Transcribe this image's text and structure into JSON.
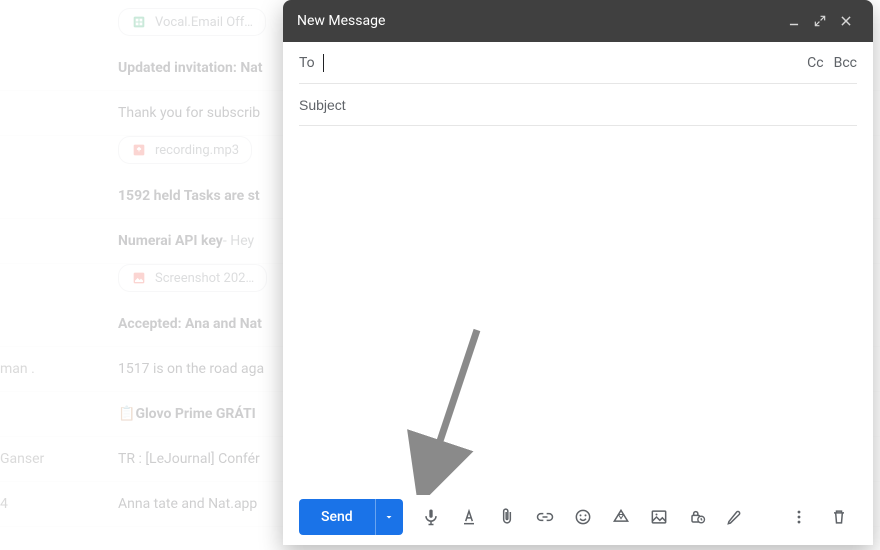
{
  "compose": {
    "title": "New Message",
    "to_label": "To",
    "cc_label": "Cc",
    "bcc_label": "Bcc",
    "subject_placeholder": "Subject",
    "send_label": "Send"
  },
  "inbox": {
    "rows": {
      "r0_chip": "Vocal.Email Off…",
      "r1": "Updated invitation: Nat",
      "r2": "Thank you for subscrib",
      "r2_chip": "recording.mp3",
      "r3": "1592 held Tasks are st",
      "r4_a": "Numerai API key",
      "r4_b": " - Hey ",
      "r4_chip": "Screenshot 202…",
      "r5": "Accepted: Ana and Nat",
      "r6": "1517 is on the road aga",
      "r7_a": "📋 ",
      "r7_b": "Glovo Prime GRÁTI",
      "r8": "TR : [LeJournal] Confér",
      "r9": "Anna tate and Nat.app ",
      "sender6": "man .",
      "sender8": "Ganser",
      "sender9": "4"
    }
  },
  "icons": {
    "minimize": "minimize",
    "expand": "expand",
    "close": "close",
    "mic": "microphone",
    "format": "format-text",
    "attach": "paperclip",
    "link": "link",
    "emoji": "emoji",
    "drive": "drive",
    "image": "image",
    "confidential": "confidential-lock-clock",
    "pen": "pen",
    "more": "more-vert",
    "trash": "trash",
    "caret": "caret-down"
  }
}
